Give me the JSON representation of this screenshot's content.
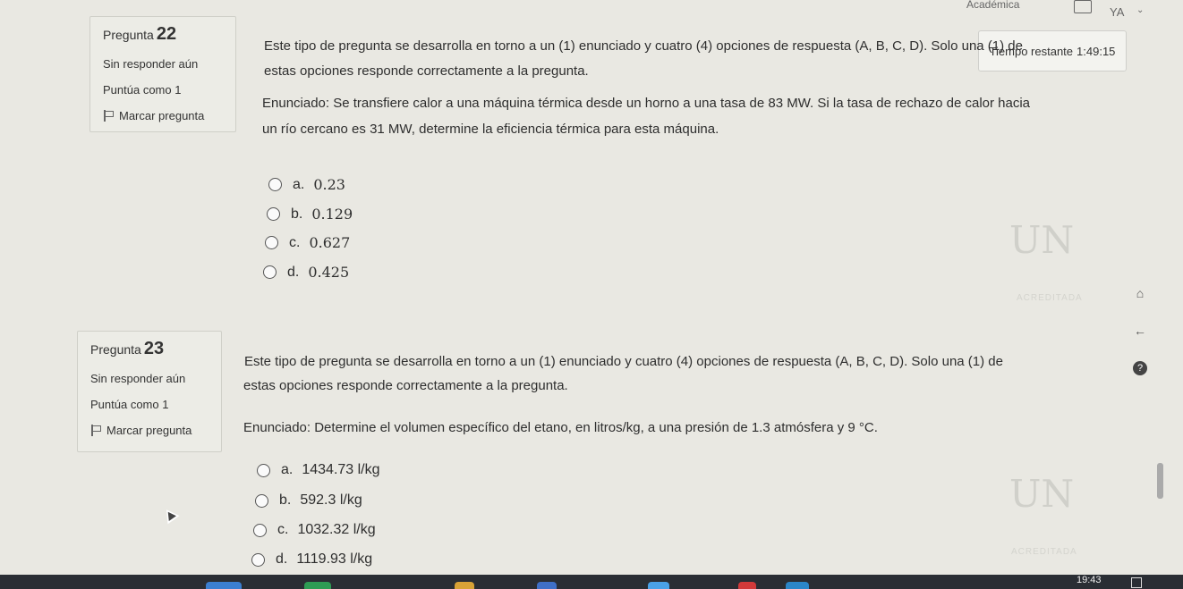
{
  "topbar": {
    "menu": "Académica",
    "avatar": "YA"
  },
  "timer": {
    "label": "Tiempo restante",
    "value": "1:49:15"
  },
  "questions": [
    {
      "label": "Pregunta",
      "number": "22",
      "status": "Sin responder aún",
      "points": "Puntúa como 1",
      "flag": "Marcar pregunta",
      "text": [
        "Este tipo de pregunta se desarrolla en torno a un (1) enunciado y cuatro (4) opciones de respuesta (A, B, C, D). Solo una (1) de",
        "estas opciones responde correctamente a la pregunta.",
        "Enunciado: Se transfiere calor a una máquina térmica desde un horno a una tasa de 83 MW. Si la tasa de rechazo de calor hacia",
        "un río cercano es 31 MW, determine la eficiencia térmica para esta máquina."
      ],
      "options": [
        {
          "letter": "a.",
          "value": "0.23"
        },
        {
          "letter": "b.",
          "value": "0.129"
        },
        {
          "letter": "c.",
          "value": "0.627"
        },
        {
          "letter": "d.",
          "value": "0.425"
        }
      ]
    },
    {
      "label": "Pregunta",
      "number": "23",
      "status": "Sin responder aún",
      "points": "Puntúa como 1",
      "flag": "Marcar pregunta",
      "text": [
        "Este tipo de pregunta se desarrolla en torno a un (1) enunciado y cuatro (4) opciones de respuesta (A, B, C, D). Solo una (1) de",
        "estas opciones responde correctamente a la pregunta.",
        "Enunciado: Determine el volumen específico del etano, en litros/kg, a una presión de 1.3 atmósfera y 9 °C."
      ],
      "options": [
        {
          "letter": "a.",
          "value": "1434.73 l/kg"
        },
        {
          "letter": "b.",
          "value": "592.3 l/kg"
        },
        {
          "letter": "c.",
          "value": "1032.32 l/kg"
        },
        {
          "letter": "d.",
          "value": "1119.93 l/kg"
        }
      ]
    }
  ],
  "watermark": {
    "logo": "UN",
    "accredited": "ACREDITADA"
  },
  "taskbar": {
    "clock": "19:43"
  }
}
